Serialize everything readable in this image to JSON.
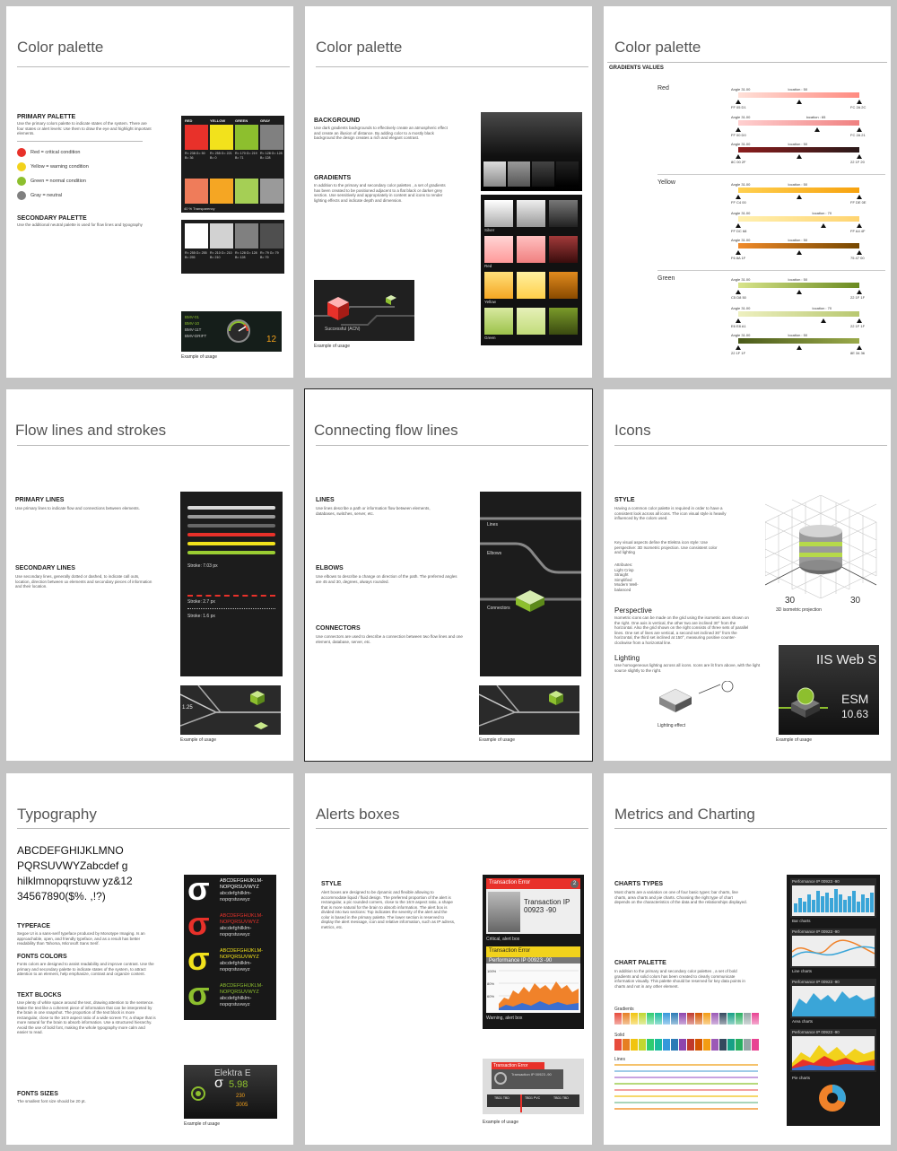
{
  "colors": {
    "red": "#e8312a",
    "yellow": "#f2e21c",
    "green": "#8dbf2e",
    "gray": "#808080",
    "orange": "#f5a623",
    "dark": "#1c1c1c"
  },
  "p1": {
    "title": "Color palette",
    "primary_heading": "PRIMARY PALETTE",
    "primary_text": "Use the primary colors palette to indicate states of the system. There are four states or alert levels: Use them to draw the eye and highlight important elements.",
    "legend": [
      {
        "label": "Red = critical condition",
        "color": "#e8312a"
      },
      {
        "label": "Yellow = warning condition",
        "color": "#f2d21c"
      },
      {
        "label": "Green = normal condition",
        "color": "#8dbf2e"
      },
      {
        "label": "Gray = neutral",
        "color": "#808080"
      }
    ],
    "secondary_heading": "SECONDARY PALETTE",
    "secondary_text": "Use the additional neutral palette is used for flow lines and typography",
    "swatch_headers": [
      "RED",
      "YELLOW",
      "GREEN",
      "GRAY"
    ],
    "swatch_values": [
      "R= 238 G= 50 B= 36",
      "R= 255 G= 221 B= 0",
      "R= 170 G= 219 B= 71",
      "R= 128 G= 128 B= 128"
    ],
    "transparency_label": "40 % Transparency",
    "gray_values": [
      "R= 255 G= 255 B= 255",
      "R= 210 G= 210 B= 210",
      "R= 128 G= 128 B= 128",
      "R= 79 G= 79 B= 79"
    ],
    "example_label": "Example of usage",
    "example_lines": [
      "BMV-01",
      "BMV-10",
      "BMV-11T",
      "BMV-DRIFT"
    ],
    "example_value": "12"
  },
  "p2": {
    "title": "Color palette",
    "background_heading": "BACKGROUND",
    "background_text": "Use dark gradients backgrounds to effectively create an atmospheric effect and create an illusion of distance. By adding color to a mostly black background the design creates a rich and elegant contrast.",
    "gradients_heading": "GRADIENTS",
    "gradients_text": "In addition to the primary and secondary color palettes , a set of gradients has been created to be positioned adjacent to a flat black or darker grey section. Use sensitively and appropriately in content and icons to render lighting effects and indicate depth and dimension.",
    "grad_labels": [
      "Silver",
      "Red",
      "Yellow",
      "Green"
    ],
    "example_label": "Example of usage",
    "example_text": "Successful (ACN)"
  },
  "p3": {
    "title": "Color palette",
    "subheading": "GRADIENTS VALUES",
    "groups": [
      "Red",
      "Yellow",
      "Green"
    ],
    "angle_label": "Angle 31.00",
    "location_labels": [
      "location : 50",
      "location : 65",
      "location : 50",
      "location : 50",
      "location : 70",
      "location : 50",
      "location : 50",
      "location : 70",
      "location : 50"
    ],
    "left_codes": [
      "FF 05 D1",
      "FF 00 D0",
      "8C 00 2F",
      "FF C4 00",
      "FF DC 68",
      "F6 8A 1F",
      "C5 D8 50",
      "E6 E8 A1",
      "22 1F 1F"
    ],
    "right_codes": [
      "FC 2A 2C",
      "FC 2A 21",
      "22 1F 20",
      "FF DE 0E",
      "FF A4 4F",
      "75 47 00",
      "22 1F 1F",
      "22 1F 1F",
      "8E 34 36"
    ]
  },
  "p4": {
    "title": "Flow lines and strokes",
    "primary_heading": "PRIMARY LINES",
    "primary_text": "Use primary lines to indicate flow and connections between elements.",
    "secondary_heading": "SECONDARY LINES",
    "secondary_text": "Use secondary lines, generally dotted or dashed, to indicate call outs, location, direction between ux elements and secondary pieces of information and their location.",
    "stroke_labels": [
      "Stroke: 7.03 px",
      "Stroke: 2.7 px",
      "Stroke: 1.6 px"
    ],
    "example_label": "Example of usage",
    "example_value": "1.25"
  },
  "p5": {
    "title": "Connecting flow lines",
    "lines_heading": "LINES",
    "lines_text": "Use lines describe a path or information flow between elements, databases, switches, server, etc.",
    "elbows_heading": "ELBOWS",
    "elbows_text": "Use elbows to describe a change on direction of the path. The preferred angles are 45 and 30, degrees, always rounded.",
    "connectors_heading": "CONNECTORS",
    "connectors_text": "Use connectors are used to describe a connection between two flow lines and one element, database, server, etc.",
    "panel_labels": [
      "Lines",
      "Elbows",
      "Connectors"
    ],
    "example_label": "Example of usage"
  },
  "p6": {
    "title": "Icons",
    "style_heading": "STYLE",
    "style_text": "Having a common color palette is required in order to have a consistent look across all icons. The icon visual style is heavily influenced by the colors used.",
    "key_text": "Key visual aspects define the Elektra icon style: Use perspective: 3D Isometric projection. Use consistent color and lighting",
    "attributes": "Attributes: Light Crisp Straight Simplified Modern Well-balanced",
    "perspective_heading": "Perspective",
    "perspective_text": "Isometric icons can be made on the grid using the isometric axes shown on the right. One axis is vertical, the other two are inclined 30° from the horizontal. Also the grid shown on the right consists of three sets of parallel lines. One set of lines are vertical, a second set inclined 30° from the horizontal, the third set inclined at 150°, measuring positive counter-clockwise from a horizontal line.",
    "lighting_heading": "Lighting",
    "lighting_text": "Use homogeneous lighting across all icons. Icons are lit from above, with the light source slightly to the right.",
    "angle_left": "30",
    "angle_right": "30",
    "projection_label": "3D isometric projection",
    "lighting_effect": "Lighting effect",
    "example_title": "IIS Web S",
    "example_sub": "ESM",
    "example_value": "10.63",
    "example_label": "Example of usage"
  },
  "p7": {
    "title": "Typography",
    "specimen": "ABCDEFGHIJKLMNO PQRSUVWYZabcdef ghilklmnopqrstuvw yz&1234567890($%. ,!?)",
    "typeface_heading": "TYPEFACE",
    "typeface_text": "Segoe UI is a sans-serif typeface produced by Monotype Imaging. Is an approachable, open, and friendly typeface, and as a result has better readability than Tahoma, Microsoft Sans Serif.",
    "fonts_colors_heading": "FONTS COLORS",
    "fonts_colors_text": "Fonts colors are designed to assist readability and improve contrast. Use the primary and secondary palette to indicate states of the system, to attract attention to an element, help emphasize, contrast and organize content.",
    "text_blocks_heading": "TEXT BLOCKS",
    "text_blocks_text": "Use plenty of white space around the text, drawing attention to the sentence. Make the text like a coherent piece of information that can be interpreted by the brain in one snapshot. The proportion of the text block is more rectangular, close to the 16:9 aspect ratio of a wide screen TV, a shape that is more natural for the brain to absorb information. Use a structured hierarchy. Avoid the use of bold font, making the whole typography more calm and easier to read.",
    "font_sizes_heading": "FONTS SIZES",
    "font_sizes_text": "The smallest font size should be 20 pt.",
    "sample_line1": "ABCDEFGHIJKLM-",
    "sample_line2": "NOPQRSUVWYZ",
    "sample_line3": "abcdefghilklm-",
    "sample_line4": "nopqrstuvwyz",
    "sample_glyph": "σ",
    "example_title": "Elektra E",
    "example_big": "5.98",
    "example_v1": "230",
    "example_v2": "3005",
    "example_label": "Example of usage"
  },
  "p8": {
    "title": "Alerts boxes",
    "style_heading": "STYLE",
    "style_text": "Alert boxes are designed to be dynamic and flexible allowing to accommodate liquid / fluid design. The preferred proportion of the alert is rectangular, a pic rounded corners, close to the 16:9 aspect ratio, a shape that is more natural for the brain to absorb information. The alert box is divided into two sections: Top indicates the severity of the alert and the color is based in the primary palette. The lower section is reserved to display the alert message, icon and relative information, such as IP adress, metrics, etc.",
    "critical_header": "Transaction  Error",
    "critical_body": "Transaction IP 00923 -90",
    "critical_badge": "2",
    "critical_label": "Critical, alert box",
    "warning_header": "Transaction  Error",
    "warning_sub": "Performance IP 00923 -90",
    "warning_label": "Warning, alert box",
    "y_ticks": [
      "100%",
      "80%",
      "60%"
    ],
    "example_header": "Transaction  Error",
    "example_body": "Transaction IP 00923 -90",
    "example_ticks": [
      "TBD1 TBD",
      "TBD1 PVC",
      "TBD1 TBD"
    ],
    "example_label": "Example of usage"
  },
  "p9": {
    "title": "Metrics and Charting",
    "chart_types_heading": "CHARTS TYPES",
    "chart_types_text": "Most charts are a variation on one of four basic types: bar charts, line charts, area charts and pie charts. Choosing the right type of chart depends on the characteristics of the data and the relationships displayed.",
    "palette_heading": "CHART PALETTE",
    "palette_text": "In addition to the primary and secondary color palettes , a set of bold gradients and solid colors has been created to clearly communicate information visually. This palette should be reserved for key data points in charts and not in any other element.",
    "gradients_label": "Gradients",
    "solid_label": "Solid",
    "lines_label": "Lines",
    "palette_colors": [
      "#e74c3c",
      "#e67e22",
      "#f1c40f",
      "#c0d72f",
      "#2ecc71",
      "#1abc9c",
      "#3498db",
      "#2c7bb6",
      "#8e44ad",
      "#c0392b",
      "#d35400",
      "#f39c12",
      "#9b59b6",
      "#34495e",
      "#16a085",
      "#27ae60",
      "#95a5a6",
      "#e84393"
    ],
    "line_colors": [
      "#f5c26b",
      "#9ecbe8",
      "#c8a2e0",
      "#b6d97a",
      "#f4a0a0",
      "#f6d86b",
      "#a8d5ba",
      "#f7b267"
    ],
    "chart_title": "Performance IP 00923 -90",
    "chart_labels": [
      "Bar charts",
      "Line charts",
      "Area charts",
      "Pie charts"
    ]
  }
}
